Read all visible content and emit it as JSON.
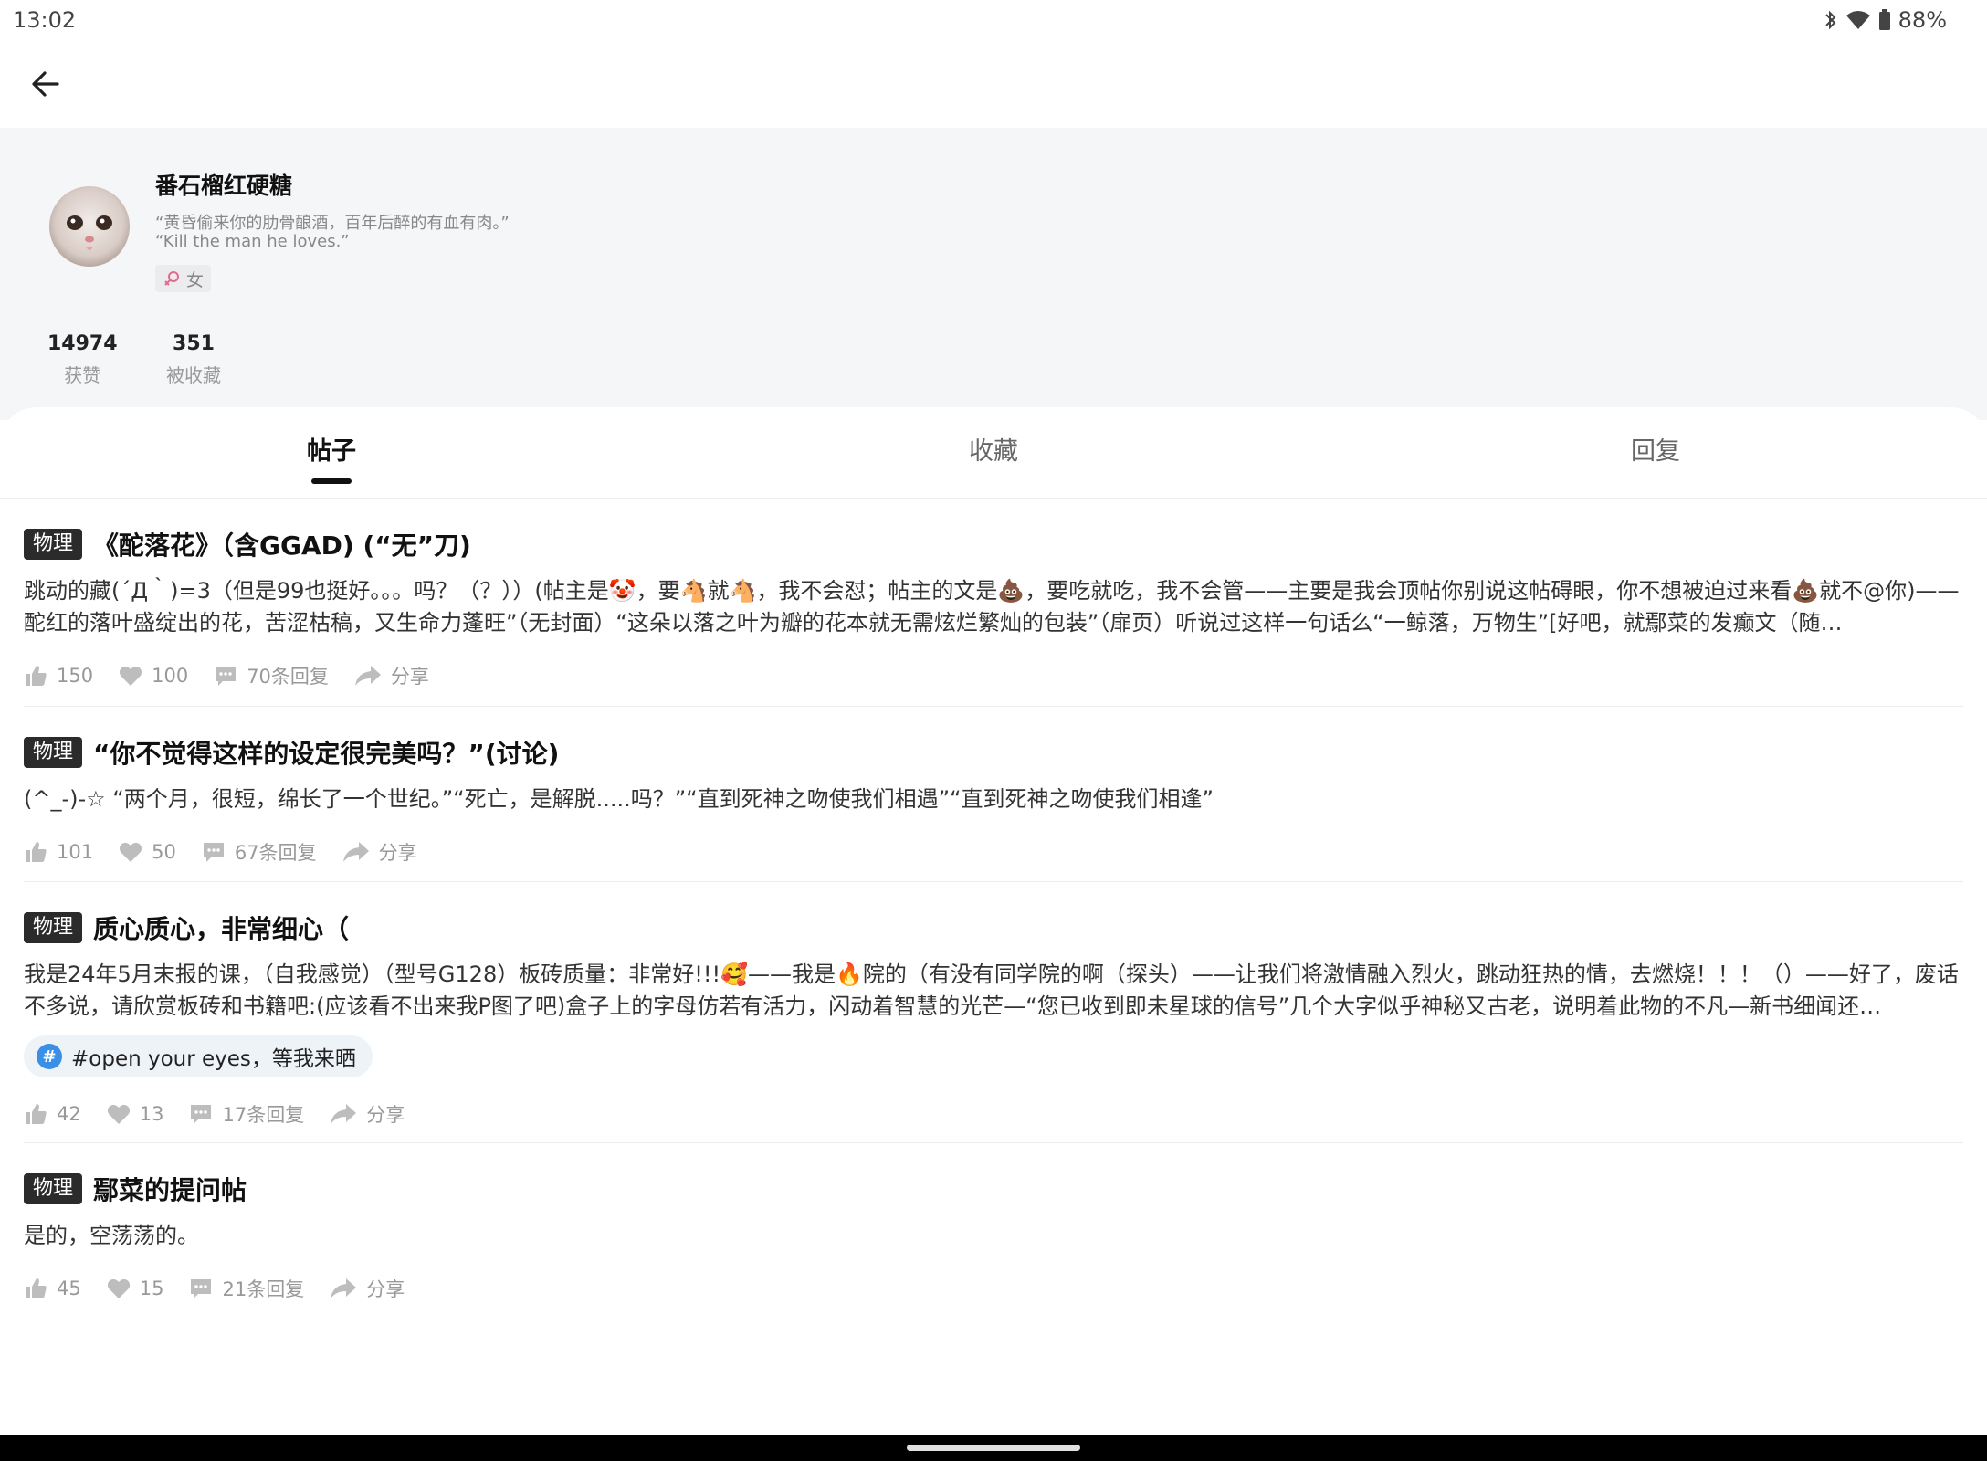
{
  "status_bar": {
    "time": "13:02",
    "battery": "88%"
  },
  "profile": {
    "username": "番石榴红硬糖",
    "bio_line1": "“黄昏偷来你的肋骨酿酒，百年后醉的有血有肉。”",
    "bio_line2": "“Kill the man he loves.”",
    "gender": "女",
    "stats": [
      {
        "value": "14974",
        "label": "获赞"
      },
      {
        "value": "351",
        "label": "被收藏"
      }
    ]
  },
  "tabs": [
    {
      "label": "帖子",
      "active": true
    },
    {
      "label": "收藏",
      "active": false
    },
    {
      "label": "回复",
      "active": false
    }
  ],
  "posts": [
    {
      "category": "物理",
      "title": "《酡落花》（含GGAD) (“无”刀)",
      "body": "跳动的藏(´Д｀)=3（但是99也挺好。。。吗？（？））(帖主是🤡，要🐴就🐴，我不会怼；帖主的文是💩，要吃就吃，我不会管——主要是我会顶帖你别说这帖碍眼，你不想被迫过来看💩就不@你)——酡红的落叶盛绽出的花，苦涩枯稿，又生命力蓬旺”（无封面）“这朵以落之叶为瓣的花本就无需炫烂繁灿的包装”（扉页）听说过这样一句话么“一鲸落，万物生”[好吧，就鄢菜的发癫文（随…",
      "likes": "150",
      "hearts": "100",
      "replies": "70条回复",
      "share": "分享"
    },
    {
      "category": "物理",
      "title": "“你不觉得这样的设定很完美吗？”(讨论)",
      "body": "(^_-)-☆ “两个月，很短，绵长了一个世纪。”“死亡，是解脱.....吗？”“直到死神之吻使我们相遇”“直到死神之吻使我们相逢”",
      "likes": "101",
      "hearts": "50",
      "replies": "67条回复",
      "share": "分享"
    },
    {
      "category": "物理",
      "title": "质心质心，非常细心（",
      "body": "我是24年5月末报的课，（自我感觉）（型号G128）板砖质量：非常好!!!🥰——我是🔥院的（有没有同学院的啊（探头）——让我们将激情融入烈火，跳动狂热的情，去燃烧！！！（）——好了，废话不多说，请欣赏板砖和书籍吧:(应该看不出来我P图了吧)盒子上的字母仿若有活力，闪动着智慧的光芒—“您已收到即未星球的信号”几个大字似乎神秘又古老，说明着此物的不凡—新书细闻还…",
      "tag": "#open your eyes，等我来晒",
      "likes": "42",
      "hearts": "13",
      "replies": "17条回复",
      "share": "分享"
    },
    {
      "category": "物理",
      "title": "鄢菜的提问帖",
      "body": "是的，空荡荡的。",
      "likes": "45",
      "hearts": "15",
      "replies": "21条回复",
      "share": "分享"
    }
  ],
  "icons": {
    "back": "arrow-left-icon",
    "like": "thumbs-up-icon",
    "heart": "heart-icon",
    "comment": "comment-icon",
    "share": "share-icon"
  }
}
